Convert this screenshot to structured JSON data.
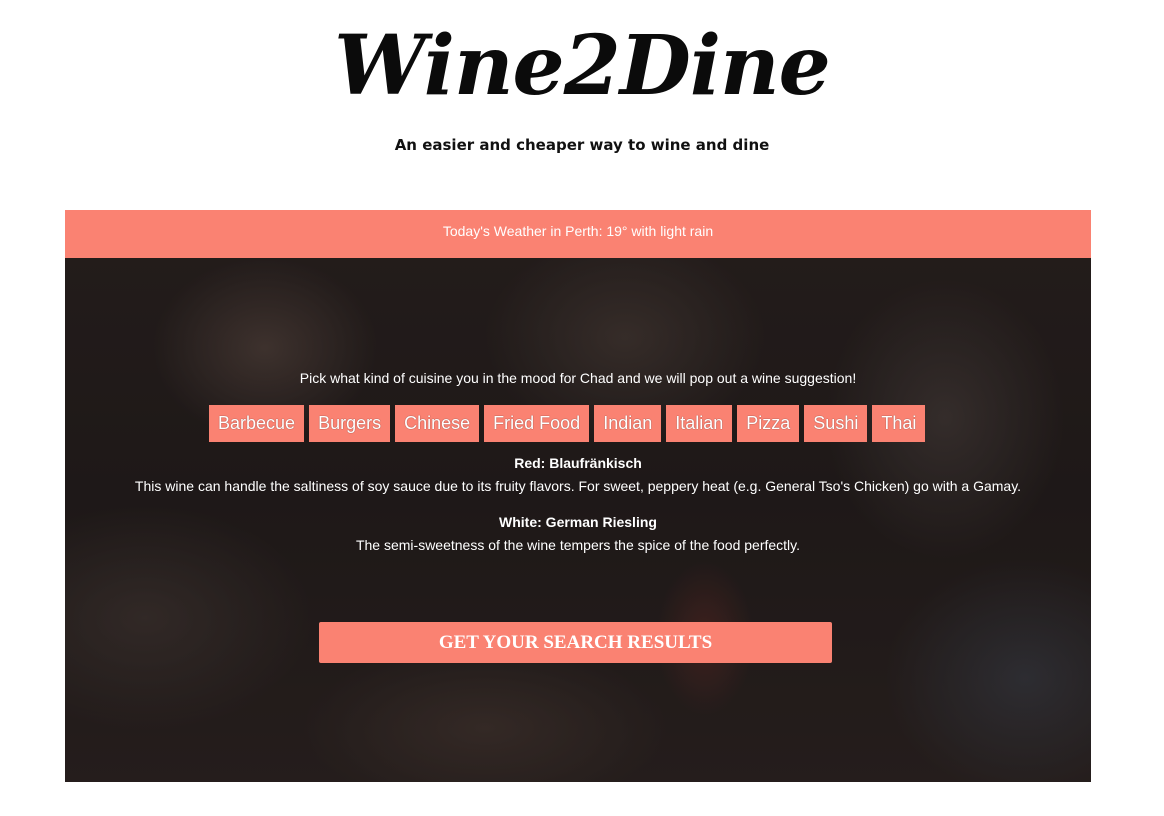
{
  "header": {
    "logo_text": "Wine2Dine",
    "tagline": "An easier and cheaper way to wine and dine"
  },
  "weather": {
    "text": "Today's Weather in Perth: 19° with light rain"
  },
  "main": {
    "prompt": "Pick what kind of cuisine you in the mood for Chad and we will pop out a wine suggestion!",
    "cuisines": [
      "Barbecue",
      "Burgers",
      "Chinese",
      "Fried Food",
      "Indian",
      "Italian",
      "Pizza",
      "Sushi",
      "Thai"
    ],
    "red": {
      "title": "Red: Blaufränkisch",
      "description": "This wine can handle the saltiness of soy sauce due to its fruity flavors. For sweet, peppery heat (e.g. General Tso's Chicken) go with a Gamay."
    },
    "white": {
      "title": "White: German Riesling",
      "description": "The semi-sweetness of the wine tempers the spice of the food perfectly."
    },
    "search_button_label": "GET YOUR SEARCH RESULTS"
  },
  "colors": {
    "accent": "#fa8272",
    "background": "#ffffff",
    "text_dark": "#111111"
  }
}
